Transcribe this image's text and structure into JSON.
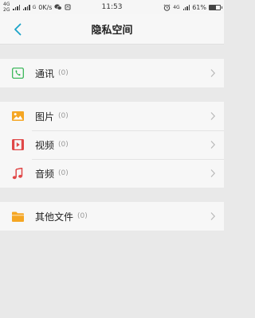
{
  "status": {
    "net_top": "4G",
    "net_bottom": "2G",
    "carrier_mark": "G",
    "speed": "0K/s",
    "time": "11:53",
    "net_right": "4G",
    "battery": "61%",
    "battery_level": 0.61
  },
  "header": {
    "title": "隐私空间"
  },
  "sections": [
    {
      "items": [
        {
          "label": "通讯",
          "count": "(0)",
          "icon": "phone-icon"
        }
      ]
    },
    {
      "items": [
        {
          "label": "图片",
          "count": "(0)",
          "icon": "image-icon"
        },
        {
          "label": "视频",
          "count": "(0)",
          "icon": "video-icon"
        },
        {
          "label": "音频",
          "count": "(0)",
          "icon": "music-icon"
        }
      ]
    },
    {
      "items": [
        {
          "label": "其他文件",
          "count": "(0)",
          "icon": "folder-icon"
        }
      ]
    }
  ],
  "colors": {
    "accent": "#1aa3c8",
    "phone": "#2bb24c",
    "image": "#f5a623",
    "video": "#e04848",
    "music": "#e04848",
    "folder": "#f5a623"
  }
}
